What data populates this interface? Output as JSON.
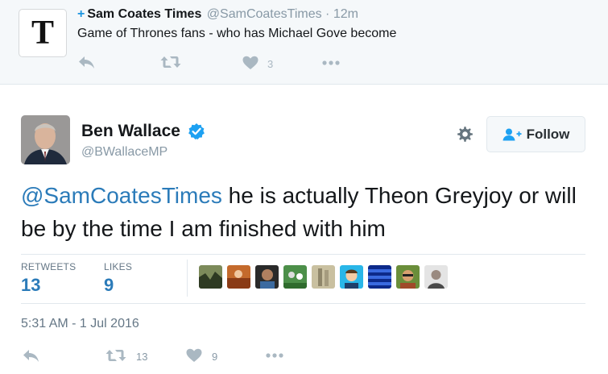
{
  "parent_tweet": {
    "follow_glyph": "+",
    "name": "Sam Coates Times",
    "handle": "@SamCoatesTimes",
    "separator": "·",
    "time": "12m",
    "text": "Game of Thrones fans - who has Michael Gove become",
    "avatar_letter": "T",
    "likes": "3"
  },
  "tweet": {
    "name": "Ben Wallace",
    "handle": "@BWallaceMP",
    "follow_label": "Follow",
    "mention": "@SamCoatesTimes",
    "text_rest": " he is actually Theon Greyjoy or will be by the time I am finished with him",
    "timestamp": "5:31 AM - 1 Jul 2016"
  },
  "stats": {
    "retweets_label": "RETWEETS",
    "retweets_value": "13",
    "likes_label": "LIKES",
    "likes_value": "9"
  },
  "actions": {
    "retweet_count": "13",
    "like_count": "9"
  },
  "colors": {
    "link": "#2b7bb9",
    "verified": "#1da1f2",
    "icon_gray": "#aab8c2"
  },
  "icons": [
    "reply-icon",
    "retweet-icon",
    "heart-icon",
    "more-icon",
    "verified-icon",
    "gear-icon",
    "follow-person-icon"
  ]
}
